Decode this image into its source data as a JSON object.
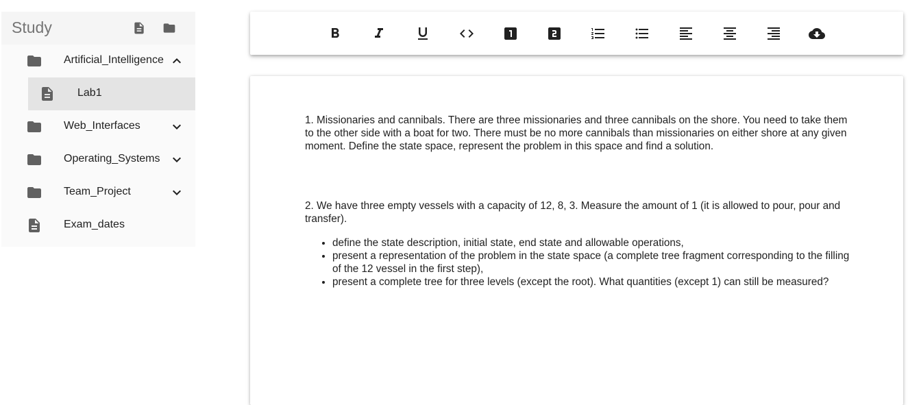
{
  "sidebar": {
    "title": "Study",
    "header_icons": [
      "new-file-icon",
      "new-folder-icon"
    ],
    "items": [
      {
        "label": "Artificial_Intelligence",
        "type": "folder",
        "expanded": true
      },
      {
        "label": "Lab1",
        "type": "file",
        "selected": true
      },
      {
        "label": "Web_Interfaces",
        "type": "folder",
        "expanded": false
      },
      {
        "label": "Operating_Systems",
        "type": "folder",
        "expanded": false
      },
      {
        "label": "Team_Project",
        "type": "folder",
        "expanded": false
      },
      {
        "label": "Exam_dates",
        "type": "file"
      }
    ]
  },
  "toolbar": {
    "buttons": [
      "bold-icon",
      "italic-icon",
      "underline-icon",
      "code-icon",
      "heading-1-icon",
      "heading-2-icon",
      "numbered-list-icon",
      "bulleted-list-icon",
      "align-left-icon",
      "align-center-icon",
      "align-right-icon",
      "cloud-download-icon"
    ]
  },
  "editor": {
    "p1": "1.  Missionaries and cannibals. There are three missionaries and three cannibals on the shore. You need to take them to the other side with a boat for two. There must be no more cannibals than missionaries on either shore at any given moment. Define the state space, represent the problem in this space and find a solution.",
    "p2": "2. We have three empty vessels with a capacity of 12, 8, 3. Measure the amount of 1 (it is allowed to pour, pour and transfer).",
    "bullets": [
      "define the state description, initial state, end state and allowable operations,",
      "present a representation of the problem in the state space (a complete tree fragment corresponding to the filling of the 12 vessel in the first step),",
      "present a complete tree for three levels (except the root). What quantities (except 1) can still be measured?"
    ]
  },
  "colors": {
    "icon_gray": "#616161",
    "selected_bg": "#e4e4e4",
    "header_bg": "#f5f5f5",
    "title_gray": "#757575"
  }
}
